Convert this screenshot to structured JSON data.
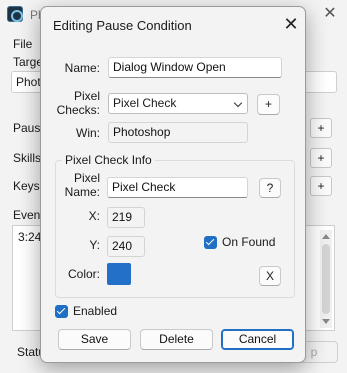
{
  "background": {
    "title": "Photoshop Sc",
    "menu_file": "File",
    "target_label": "Targe",
    "target_value": "Photo",
    "pause_label": "Pause",
    "skills_label": "Skills",
    "keys_label": "Keys:",
    "events_label": "Event",
    "events_value": "3:24",
    "status_label": "Statu",
    "stop_label": "p",
    "plus_label": "+"
  },
  "dialog": {
    "title": "Editing Pause Condition",
    "name_label": "Name:",
    "name_value": "Dialog Window Open",
    "pixel_checks_label": "Pixel\nChecks:",
    "pixel_checks_value": "Pixel Check",
    "add_label": "+",
    "win_label": "Win:",
    "win_value": "Photoshop",
    "group_title": "Pixel Check Info",
    "pixel_name_label": "Pixel\nName:",
    "pixel_name_value": "Pixel Check",
    "help_label": "?",
    "x_label": "X:",
    "x_value": "219",
    "y_label": "Y:",
    "y_value": "240",
    "on_found_label": "On Found",
    "on_found_checked": true,
    "color_label": "Color:",
    "color_value": "#2370c9",
    "clear_color_label": "X",
    "enabled_label": "Enabled",
    "enabled_checked": true,
    "save_label": "Save",
    "delete_label": "Delete",
    "cancel_label": "Cancel"
  }
}
